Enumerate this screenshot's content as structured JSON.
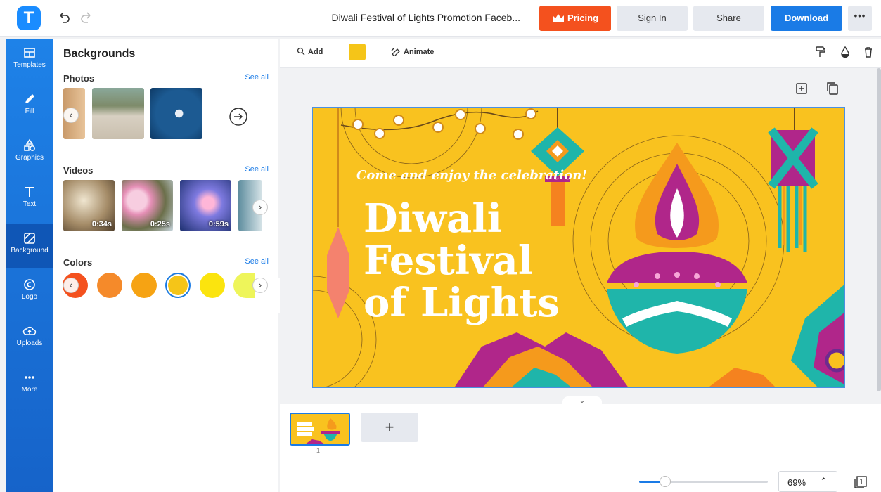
{
  "header": {
    "doc_title": "Diwali Festival of Lights Promotion Faceb...",
    "pricing_label": "Pricing",
    "signin_label": "Sign In",
    "share_label": "Share",
    "download_label": "Download",
    "more_label": "•••",
    "logo_letter": "T"
  },
  "sidebar": {
    "items": [
      {
        "label": "Templates",
        "icon": "templates-icon"
      },
      {
        "label": "Fill",
        "icon": "pencil-icon"
      },
      {
        "label": "Graphics",
        "icon": "shapes-icon"
      },
      {
        "label": "Text",
        "icon": "text-icon"
      },
      {
        "label": "Background",
        "icon": "background-icon"
      },
      {
        "label": "Logo",
        "icon": "logo-icon"
      },
      {
        "label": "Uploads",
        "icon": "cloud-upload-icon"
      },
      {
        "label": "More",
        "icon": "more-dots-icon"
      }
    ],
    "active": "Background"
  },
  "panel": {
    "title": "Backgrounds",
    "photos_title": "Photos",
    "videos_title": "Videos",
    "colors_title": "Colors",
    "see_all": "See all",
    "videos": [
      {
        "duration": "0:34s"
      },
      {
        "duration": "0:25s"
      },
      {
        "duration": "0:59s"
      }
    ],
    "colors": [
      "#f4511e",
      "#f58a2a",
      "#f6a313",
      "#f5c518",
      "#fbe40e",
      "#eef55a"
    ],
    "selected_color": "#f5c518"
  },
  "toolbar": {
    "add_label": "Add",
    "animate_label": "Animate",
    "color": "#f5c518"
  },
  "design": {
    "subtitle": "Come and enjoy the celebration!",
    "line1": "Diwali",
    "line2": "Festival",
    "line3": "of Lights"
  },
  "pages": {
    "page_number": "1",
    "add_label": "+"
  },
  "zoom": {
    "value": "69%",
    "level": 0.69
  }
}
